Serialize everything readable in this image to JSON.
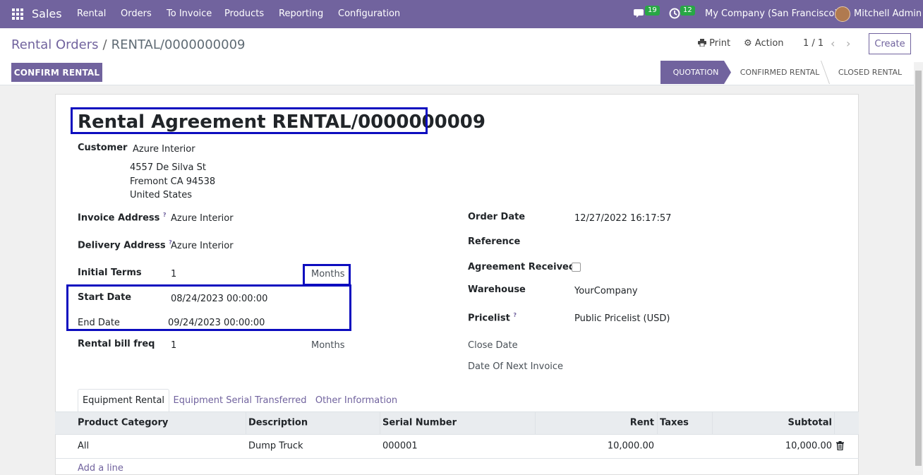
{
  "nav": {
    "app": "Sales",
    "menu": [
      "Rental",
      "Orders",
      "To Invoice",
      "Products",
      "Reporting",
      "Configuration"
    ],
    "messages_count": "19",
    "activities_count": "12",
    "company": "My Company (San Francisco)",
    "user": "Mitchell Admin"
  },
  "control": {
    "breadcrumb_parent": "Rental Orders",
    "breadcrumb_sep": "/",
    "breadcrumb_current": "RENTAL/0000000009",
    "print": "Print",
    "action": "Action",
    "pager": "1 / 1",
    "create": "Create",
    "confirm": "CONFIRM RENTAL",
    "stages": [
      "QUOTATION",
      "CONFIRMED RENTAL",
      "CLOSED RENTAL"
    ]
  },
  "form": {
    "title": "Rental Agreement RENTAL/0000000009",
    "customer_label": "Customer",
    "customer": "Azure Interior",
    "address1": "4557 De Silva St",
    "address2": "Fremont CA 94538",
    "address3": "United States",
    "invoice_address_label": "Invoice Address",
    "invoice_address": "Azure Interior",
    "delivery_address_label": "Delivery Address",
    "delivery_address": "Azure Interior",
    "initial_terms_label": "Initial Terms",
    "initial_terms": "1",
    "initial_terms_unit": "Months",
    "start_date_label": "Start Date",
    "start_date": "08/24/2023 00:00:00",
    "end_date_label": "End Date",
    "end_date": "09/24/2023 00:00:00",
    "bill_freq_label": "Rental bill freq",
    "bill_freq": "1",
    "bill_freq_unit": "Months",
    "order_date_label": "Order Date",
    "order_date": "12/27/2022 16:17:57",
    "reference_label": "Reference",
    "agreement_label": "Agreement Received?",
    "warehouse_label": "Warehouse",
    "warehouse": "YourCompany",
    "pricelist_label": "Pricelist",
    "pricelist": "Public Pricelist (USD)",
    "close_date_label": "Close Date",
    "next_invoice_label": "Date Of Next Invoice",
    "help_mark": "?"
  },
  "tabs": [
    "Equipment Rental",
    "Equipment Serial Transferred",
    "Other Information"
  ],
  "table": {
    "headers": [
      "Product Category",
      "Description",
      "Serial Number",
      "Rent",
      "Taxes",
      "Subtotal"
    ],
    "row": [
      "All",
      "Dump Truck",
      "000001",
      "10,000.00",
      "",
      "10,000.00"
    ],
    "add_line": "Add a line"
  }
}
